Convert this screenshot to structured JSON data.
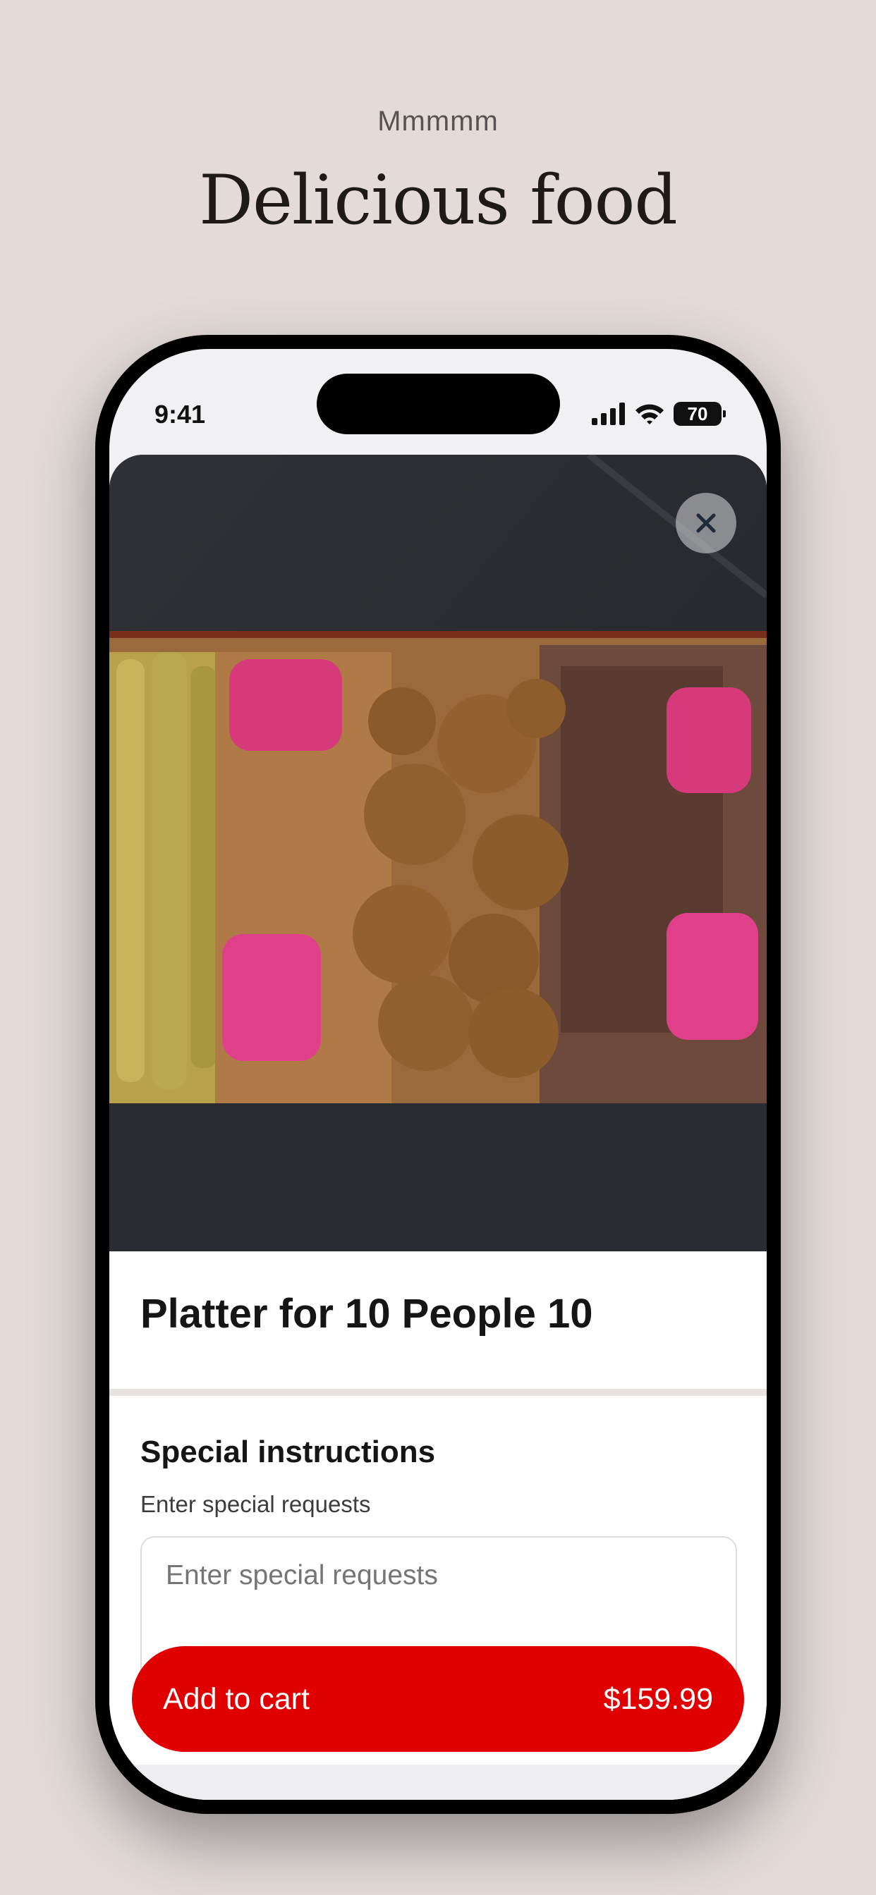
{
  "page": {
    "eyebrow": "Mmmmm",
    "headline": "Delicious food"
  },
  "status_bar": {
    "time": "9:41",
    "battery": "70",
    "icons": [
      "cellular-signal-icon",
      "wifi-icon",
      "battery-icon"
    ]
  },
  "product": {
    "image_subject": "shawarma platter with falafel, chicken, beef, kebabs and pickled turnips",
    "title": "Platter for 10 People 10"
  },
  "special_instructions": {
    "heading": "Special instructions",
    "label": "Enter special requests",
    "placeholder": "Enter special requests",
    "value": ""
  },
  "cart_button": {
    "label": "Add to cart",
    "price": "$159.99"
  },
  "colors": {
    "background": "#e4dbd9",
    "accent": "#e10000",
    "text": "#151515"
  }
}
